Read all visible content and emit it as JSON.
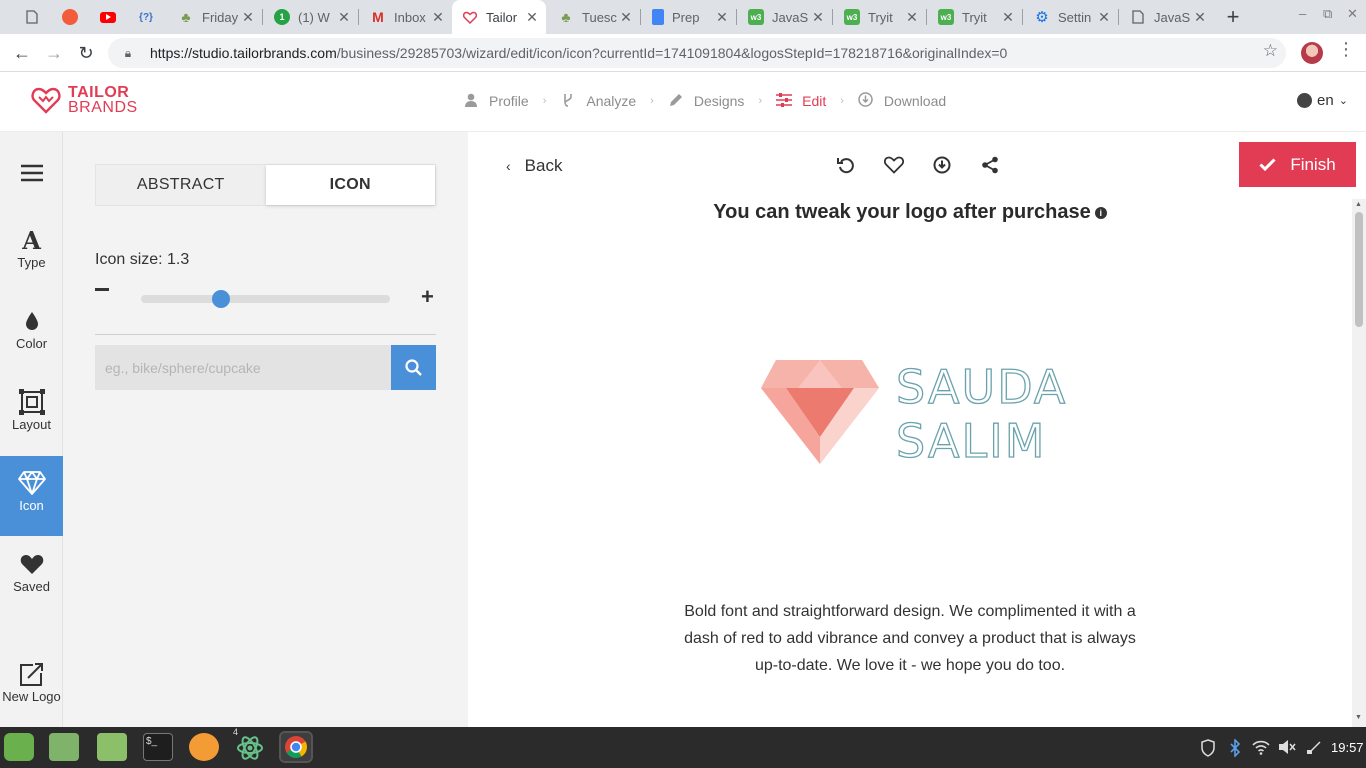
{
  "browser": {
    "tabs": [
      {
        "title": "",
        "icon": "doc-icon",
        "pinned": true
      },
      {
        "title": "",
        "icon": "shutter-icon",
        "pinned": true
      },
      {
        "title": "",
        "icon": "youtube-icon",
        "pinned": true
      },
      {
        "title": "",
        "icon": "json-icon",
        "pinned": true
      },
      {
        "title": "Friday",
        "icon": "tree-icon"
      },
      {
        "title": "(1) W",
        "icon": "whatsapp-icon"
      },
      {
        "title": "Inbox",
        "icon": "gmail-icon"
      },
      {
        "title": "Tailor",
        "icon": "heart-icon",
        "active": true
      },
      {
        "title": "Tuesc",
        "icon": "tree-icon"
      },
      {
        "title": "Prep",
        "icon": "docs-icon"
      },
      {
        "title": "JavaS",
        "icon": "w3-icon"
      },
      {
        "title": "Tryit",
        "icon": "w3-icon"
      },
      {
        "title": "Tryit",
        "icon": "w3-icon"
      },
      {
        "title": "Settin",
        "icon": "settings-icon"
      },
      {
        "title": "JavaS",
        "icon": "doc-icon"
      }
    ],
    "url_host": "https://studio.tailorbrands.com",
    "url_path": "/business/29285703/wizard/edit/icon/icon?currentId=1741091804&logosStepId=178218716&originalIndex=0"
  },
  "header": {
    "logo_line1": "TAILOR",
    "logo_line2": "BRANDS",
    "steps": [
      {
        "label": "Profile",
        "icon": "user-icon"
      },
      {
        "label": "Analyze",
        "icon": "fork-icon"
      },
      {
        "label": "Designs",
        "icon": "pencil-icon"
      },
      {
        "label": "Edit",
        "icon": "sliders-icon",
        "active": true
      },
      {
        "label": "Download",
        "icon": "download-circle-icon"
      }
    ],
    "language": "en"
  },
  "rail": {
    "items": [
      {
        "label": "",
        "icon": "hamburger-icon"
      },
      {
        "label": "Type",
        "icon": "type-icon"
      },
      {
        "label": "Color",
        "icon": "drop-icon"
      },
      {
        "label": "Layout",
        "icon": "layout-icon"
      },
      {
        "label": "Icon",
        "icon": "diamond-icon",
        "active": true
      },
      {
        "label": "Saved",
        "icon": "heart-icon"
      },
      {
        "label": "New Logo",
        "icon": "new-logo-icon"
      }
    ]
  },
  "panel": {
    "tab_abstract": "ABSTRACT",
    "tab_icon": "ICON",
    "icon_size_label": "Icon size: 1.3",
    "icon_size_fraction": 0.32,
    "search_placeholder": "eg., bike/sphere/cupcake"
  },
  "preview": {
    "back_label": "Back",
    "finish_label": "Finish",
    "tweak_text": "You can tweak your logo after purchase",
    "logo_line1": "SAUDA",
    "logo_line2": "SALIM",
    "description": "Bold font and straightforward design. We complimented it with a dash of red to add vibrance and convey a product that is always up-to-date. We love it - we hope you do too.",
    "accent_color": "#e23c55",
    "logo_pink": "#f4a9a0",
    "logo_outline": "#6aa3ad"
  },
  "taskbar": {
    "clock": "19:57",
    "badge": "4",
    "apps": [
      "mint-menu-icon",
      "files-icon",
      "folder-icon",
      "terminal-icon",
      "firefox-icon",
      "atom-icon",
      "chrome-icon"
    ]
  }
}
